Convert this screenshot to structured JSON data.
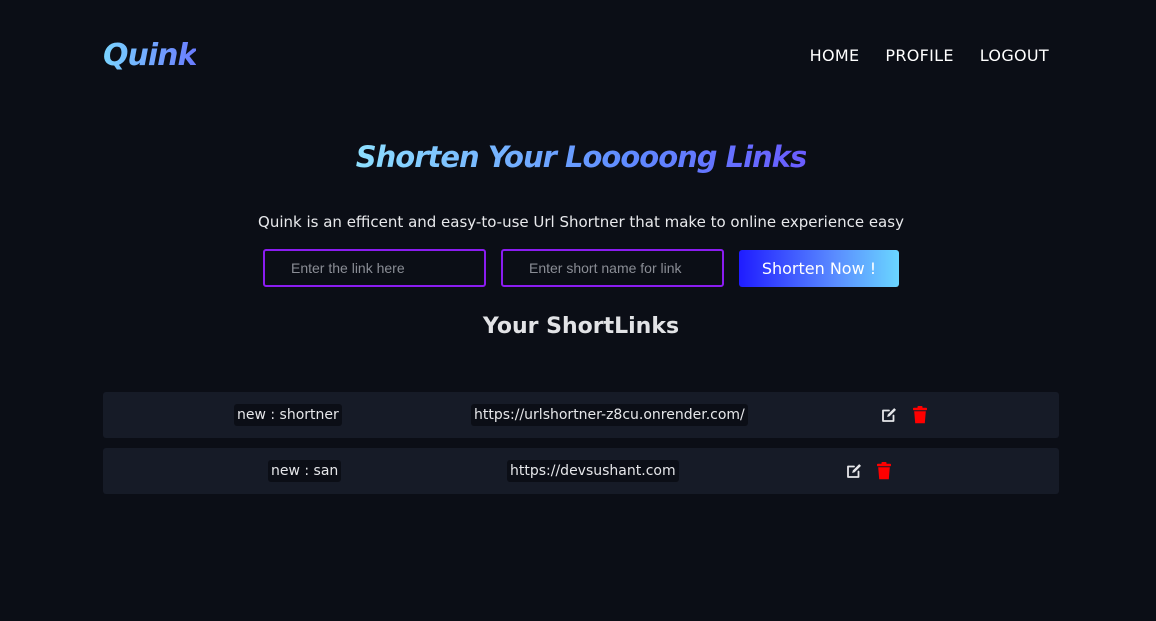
{
  "nav": {
    "logo": "Quink",
    "items": [
      "HOME",
      "PROFILE",
      "LOGOUT"
    ]
  },
  "hero": {
    "headline": "Shorten Your Looooong Links",
    "subtitle": "Quink is an efficent and easy-to-use Url Shortner that make to online experience easy"
  },
  "form": {
    "link_placeholder": "Enter the link here",
    "name_placeholder": "Enter short name for link",
    "button_label": "Shorten Now !"
  },
  "links": {
    "title": "Your ShortLinks",
    "rows": [
      {
        "name": "new : shortner",
        "url": "https://urlshortner-z8cu.onrender.com/",
        "edit_icon": "edit-icon",
        "delete_icon": "trash-icon"
      },
      {
        "name": "new : san",
        "url": "https://devsushant.com",
        "edit_icon": "edit-icon",
        "delete_icon": "trash-icon"
      }
    ]
  },
  "colors": {
    "background": "#0b0e16",
    "row_background": "#161b27",
    "input_border": "#8a1cf0",
    "delete_icon": "#ff0000"
  }
}
